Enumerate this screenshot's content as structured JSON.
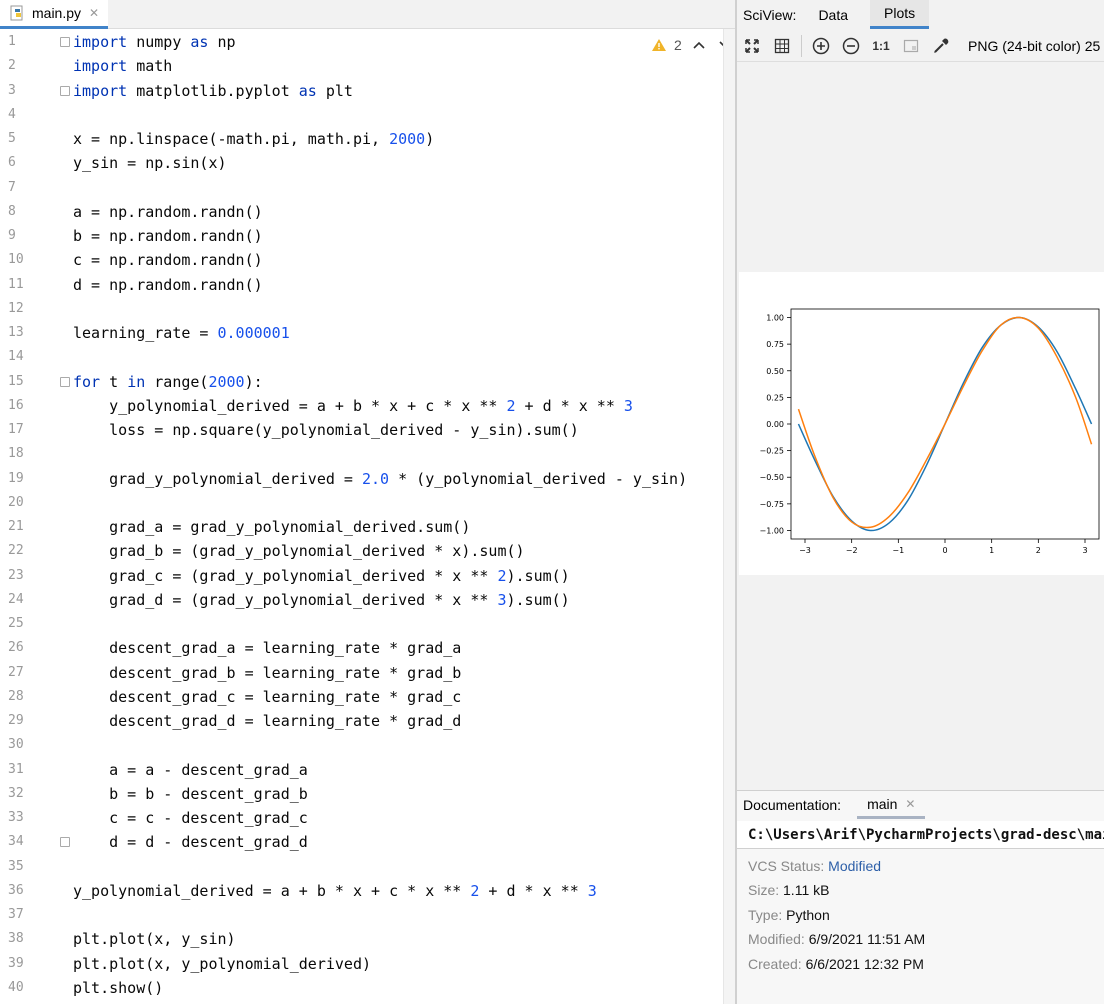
{
  "editor": {
    "tab": {
      "label": "main.py",
      "close": "✕"
    },
    "warnings": {
      "count": "2"
    },
    "lines": [
      [
        [
          "kw",
          "import"
        ],
        [
          "t",
          " numpy "
        ],
        [
          "kw",
          "as"
        ],
        [
          "t",
          " np"
        ]
      ],
      [
        [
          "kw",
          "import"
        ],
        [
          "t",
          " math"
        ]
      ],
      [
        [
          "kw",
          "import"
        ],
        [
          "t",
          " matplotlib.pyplot "
        ],
        [
          "kw",
          "as"
        ],
        [
          "t",
          " plt"
        ]
      ],
      [],
      [
        [
          "t",
          "x = np.linspace(-math.pi, math.pi, "
        ],
        [
          "nm",
          "2000"
        ],
        [
          "t",
          ")"
        ]
      ],
      [
        [
          "t",
          "y_sin = np.sin(x)"
        ]
      ],
      [],
      [
        [
          "t",
          "a = np.random.randn()"
        ]
      ],
      [
        [
          "t",
          "b = np.random.randn()"
        ]
      ],
      [
        [
          "t",
          "c = np.random.randn()"
        ]
      ],
      [
        [
          "t",
          "d = np.random.randn()"
        ]
      ],
      [],
      [
        [
          "t",
          "learning_rate = "
        ],
        [
          "nm",
          "0.000001"
        ]
      ],
      [],
      [
        [
          "kw",
          "for"
        ],
        [
          "t",
          " t "
        ],
        [
          "kw",
          "in"
        ],
        [
          "t",
          " range("
        ],
        [
          "nm",
          "2000"
        ],
        [
          "t",
          "):"
        ]
      ],
      [
        [
          "t",
          "    y_polynomial_derived = a + b * x + c * x ** "
        ],
        [
          "nm",
          "2"
        ],
        [
          "t",
          " + d * x ** "
        ],
        [
          "nm",
          "3"
        ]
      ],
      [
        [
          "t",
          "    loss = np.square(y_polynomial_derived - y_sin).sum()"
        ]
      ],
      [],
      [
        [
          "t",
          "    grad_y_polynomial_derived = "
        ],
        [
          "nm",
          "2.0"
        ],
        [
          "t",
          " * (y_polynomial_derived - y_sin)"
        ]
      ],
      [],
      [
        [
          "t",
          "    grad_a = grad_y_polynomial_derived.sum()"
        ]
      ],
      [
        [
          "t",
          "    grad_b = (grad_y_polynomial_derived * x).sum()"
        ]
      ],
      [
        [
          "t",
          "    grad_c = (grad_y_polynomial_derived * x ** "
        ],
        [
          "nm",
          "2"
        ],
        [
          "t",
          ").sum()"
        ]
      ],
      [
        [
          "t",
          "    grad_d = (grad_y_polynomial_derived * x ** "
        ],
        [
          "nm",
          "3"
        ],
        [
          "t",
          ").sum()"
        ]
      ],
      [],
      [
        [
          "t",
          "    descent_grad_a = learning_rate * grad_a"
        ]
      ],
      [
        [
          "t",
          "    descent_grad_b = learning_rate * grad_b"
        ]
      ],
      [
        [
          "t",
          "    descent_grad_c = learning_rate * grad_c"
        ]
      ],
      [
        [
          "t",
          "    descent_grad_d = learning_rate * grad_d"
        ]
      ],
      [],
      [
        [
          "t",
          "    a = a - descent_grad_a"
        ]
      ],
      [
        [
          "t",
          "    b = b - descent_grad_b"
        ]
      ],
      [
        [
          "t",
          "    c = c - descent_grad_c"
        ]
      ],
      [
        [
          "t",
          "    d = d - descent_grad_d"
        ]
      ],
      [],
      [
        [
          "t",
          "y_polynomial_derived = a + b * x + c * x ** "
        ],
        [
          "nm",
          "2"
        ],
        [
          "t",
          " + d * x ** "
        ],
        [
          "nm",
          "3"
        ]
      ],
      [],
      [
        [
          "t",
          "plt.plot(x, y_sin)"
        ]
      ],
      [
        [
          "t",
          "plt.plot(x, y_polynomial_derived)"
        ]
      ],
      [
        [
          "t",
          "plt.show()"
        ]
      ]
    ],
    "colors": {
      "keyword": "#0033b3",
      "number": "#1750eb",
      "text": "#080808"
    }
  },
  "sciview": {
    "title": "SciView:",
    "tabs": [
      "Data",
      "Plots"
    ],
    "active_tab": "Plots",
    "toolbar": {
      "one_to_one": "1:1",
      "image_info": "PNG (24-bit color) 25",
      "icons": [
        "fit-icon",
        "grid-icon",
        "zoom-in-icon",
        "zoom-out-icon",
        "actual-size-icon",
        "background-icon",
        "color-picker-icon"
      ]
    }
  },
  "chart_data": {
    "type": "line",
    "title": "",
    "xlabel": "",
    "ylabel": "",
    "xlim": [
      -3.3,
      3.3
    ],
    "ylim": [
      -1.08,
      1.08
    ],
    "xticks": [
      -3,
      -2,
      -1,
      0,
      1,
      2,
      3
    ],
    "xtick_labels": [
      "−3",
      "−2",
      "−1",
      "0",
      "1",
      "2",
      "3"
    ],
    "yticks": [
      1.0,
      0.75,
      0.5,
      0.25,
      0.0,
      -0.25,
      -0.5,
      -0.75,
      -1.0
    ],
    "ytick_labels": [
      "1.00",
      "0.75",
      "0.50",
      "0.25",
      "0.00",
      "−0.25",
      "−0.50",
      "−0.75",
      "−1.00"
    ],
    "grid": false,
    "series": [
      {
        "color": "#1f77b4",
        "x": [
          -3.14,
          -2.8,
          -2.4,
          -2.0,
          -1.6,
          -1.2,
          -0.8,
          -0.4,
          0.0,
          0.4,
          0.8,
          1.2,
          1.6,
          2.0,
          2.4,
          2.8,
          3.14
        ],
        "y": [
          0.0,
          -0.33,
          -0.68,
          -0.91,
          -1.0,
          -0.93,
          -0.72,
          -0.39,
          0.0,
          0.39,
          0.72,
          0.93,
          1.0,
          0.91,
          0.68,
          0.33,
          0.0
        ]
      },
      {
        "color": "#ff7f0e",
        "x": [
          -3.14,
          -2.8,
          -2.4,
          -2.0,
          -1.6,
          -1.2,
          -0.8,
          -0.4,
          0.0,
          0.4,
          0.8,
          1.2,
          1.6,
          2.0,
          2.4,
          2.8,
          3.14
        ],
        "y": [
          0.14,
          -0.29,
          -0.69,
          -0.92,
          -0.97,
          -0.87,
          -0.65,
          -0.34,
          0.0,
          0.36,
          0.69,
          0.93,
          1.0,
          0.9,
          0.63,
          0.25,
          -0.19
        ]
      }
    ]
  },
  "documentation": {
    "title": "Documentation:",
    "tab": "main",
    "close": "✕",
    "path": "C:\\Users\\Arif\\PycharmProjects\\grad-desc\\main.py",
    "fields": [
      {
        "key": "VCS Status:",
        "value": "Modified",
        "link": true
      },
      {
        "key": "Size:",
        "value": "1.11 kB",
        "link": false
      },
      {
        "key": "Type:",
        "value": "Python",
        "link": false
      },
      {
        "key": "Modified:",
        "value": "6/9/2021 11:51 AM",
        "link": false
      },
      {
        "key": "Created:",
        "value": "6/6/2021 12:32 PM",
        "link": false
      }
    ]
  }
}
